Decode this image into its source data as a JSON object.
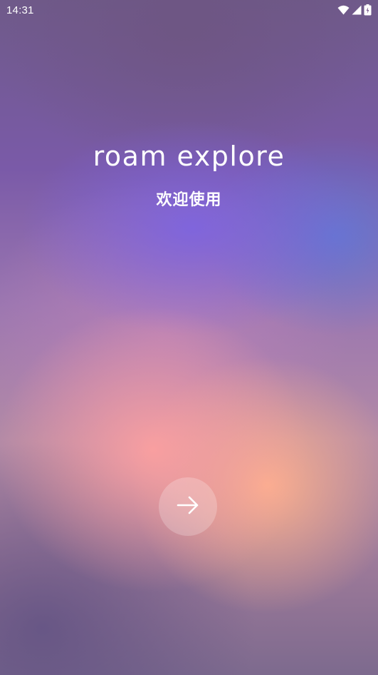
{
  "status_bar": {
    "time": "14:31",
    "icons": [
      "wifi-icon",
      "cellular-signal-icon",
      "battery-charging-icon"
    ]
  },
  "splash": {
    "brand_title": "roam explore",
    "welcome_text": "欢迎使用",
    "next_button_icon": "arrow-right-icon"
  },
  "colors": {
    "text": "#ffffff",
    "button_bg": "rgba(255,255,255,0.22)"
  }
}
